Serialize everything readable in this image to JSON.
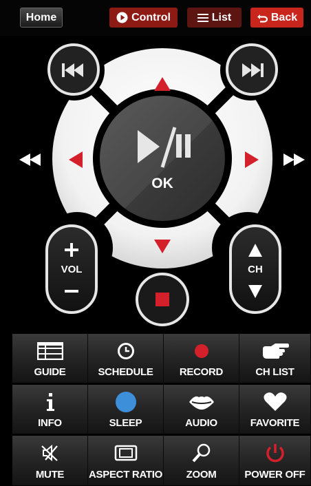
{
  "header": {
    "home_label": "Home",
    "control_label": "Control",
    "list_label": "List",
    "back_label": "Back"
  },
  "remote": {
    "ok_label": "OK",
    "vol_label": "VOL",
    "ch_label": "CH"
  },
  "grid": [
    {
      "label": "GUIDE",
      "icon": "guide-icon"
    },
    {
      "label": "SCHEDULE",
      "icon": "clock-icon"
    },
    {
      "label": "RECORD",
      "icon": "record-icon"
    },
    {
      "label": "CH LIST",
      "icon": "hand-pointer-icon"
    },
    {
      "label": "INFO",
      "icon": "info-icon"
    },
    {
      "label": "SLEEP",
      "icon": "sleep-icon"
    },
    {
      "label": "AUDIO",
      "icon": "lips-icon"
    },
    {
      "label": "FAVORITE",
      "icon": "heart-icon"
    },
    {
      "label": "MUTE",
      "icon": "mute-icon"
    },
    {
      "label": "ASPECT RATIO",
      "icon": "aspect-ratio-icon"
    },
    {
      "label": "ZOOM",
      "icon": "zoom-icon"
    },
    {
      "label": "POWER OFF",
      "icon": "power-icon"
    }
  ],
  "colors": {
    "accent_red": "#d3202a",
    "sleep_blue": "#3d8fd9",
    "background": "#000000"
  }
}
